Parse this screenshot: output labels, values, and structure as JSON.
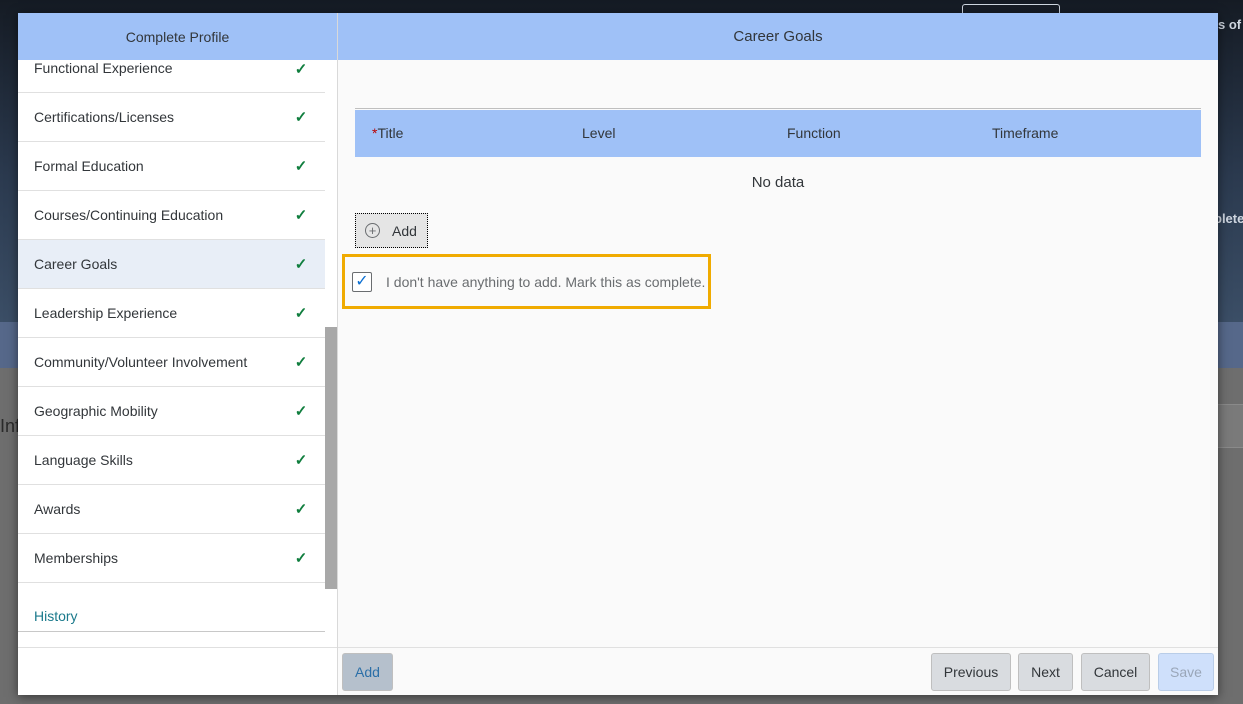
{
  "background": {
    "top_right_fragment": "s of",
    "right_mid_fragment": "plete",
    "left_fragment": "Inf"
  },
  "sidebar": {
    "title": "Complete Profile",
    "items": [
      {
        "label": "Functional Experience",
        "complete": true
      },
      {
        "label": "Certifications/Licenses",
        "complete": true
      },
      {
        "label": "Formal Education",
        "complete": true
      },
      {
        "label": "Courses/Continuing Education",
        "complete": true
      },
      {
        "label": "Career Goals",
        "complete": true,
        "selected": true
      },
      {
        "label": "Leadership Experience",
        "complete": true
      },
      {
        "label": "Community/Volunteer Involvement",
        "complete": true
      },
      {
        "label": "Geographic Mobility",
        "complete": true
      },
      {
        "label": "Language Skills",
        "complete": true
      },
      {
        "label": "Awards",
        "complete": true
      },
      {
        "label": "Memberships",
        "complete": true
      }
    ],
    "check_glyph": "✓",
    "history_label": "History"
  },
  "main": {
    "title": "Career Goals",
    "table": {
      "columns": [
        "Title",
        "Level",
        "Function",
        "Timeframe"
      ],
      "required_marker": "*",
      "empty_text": "No data"
    },
    "add_button_label": "Add",
    "complete_checkbox": {
      "checked": true,
      "label": "I don't have anything to add. Mark this as complete."
    }
  },
  "footer": {
    "add_label": "Add",
    "previous_label": "Previous",
    "next_label": "Next",
    "cancel_label": "Cancel",
    "save_label": "Save"
  },
  "colors": {
    "header_blue": "#9fc1f7",
    "check_green": "#107e3e",
    "highlight_orange": "#f0ab00",
    "link_teal": "#1b7a8c"
  }
}
